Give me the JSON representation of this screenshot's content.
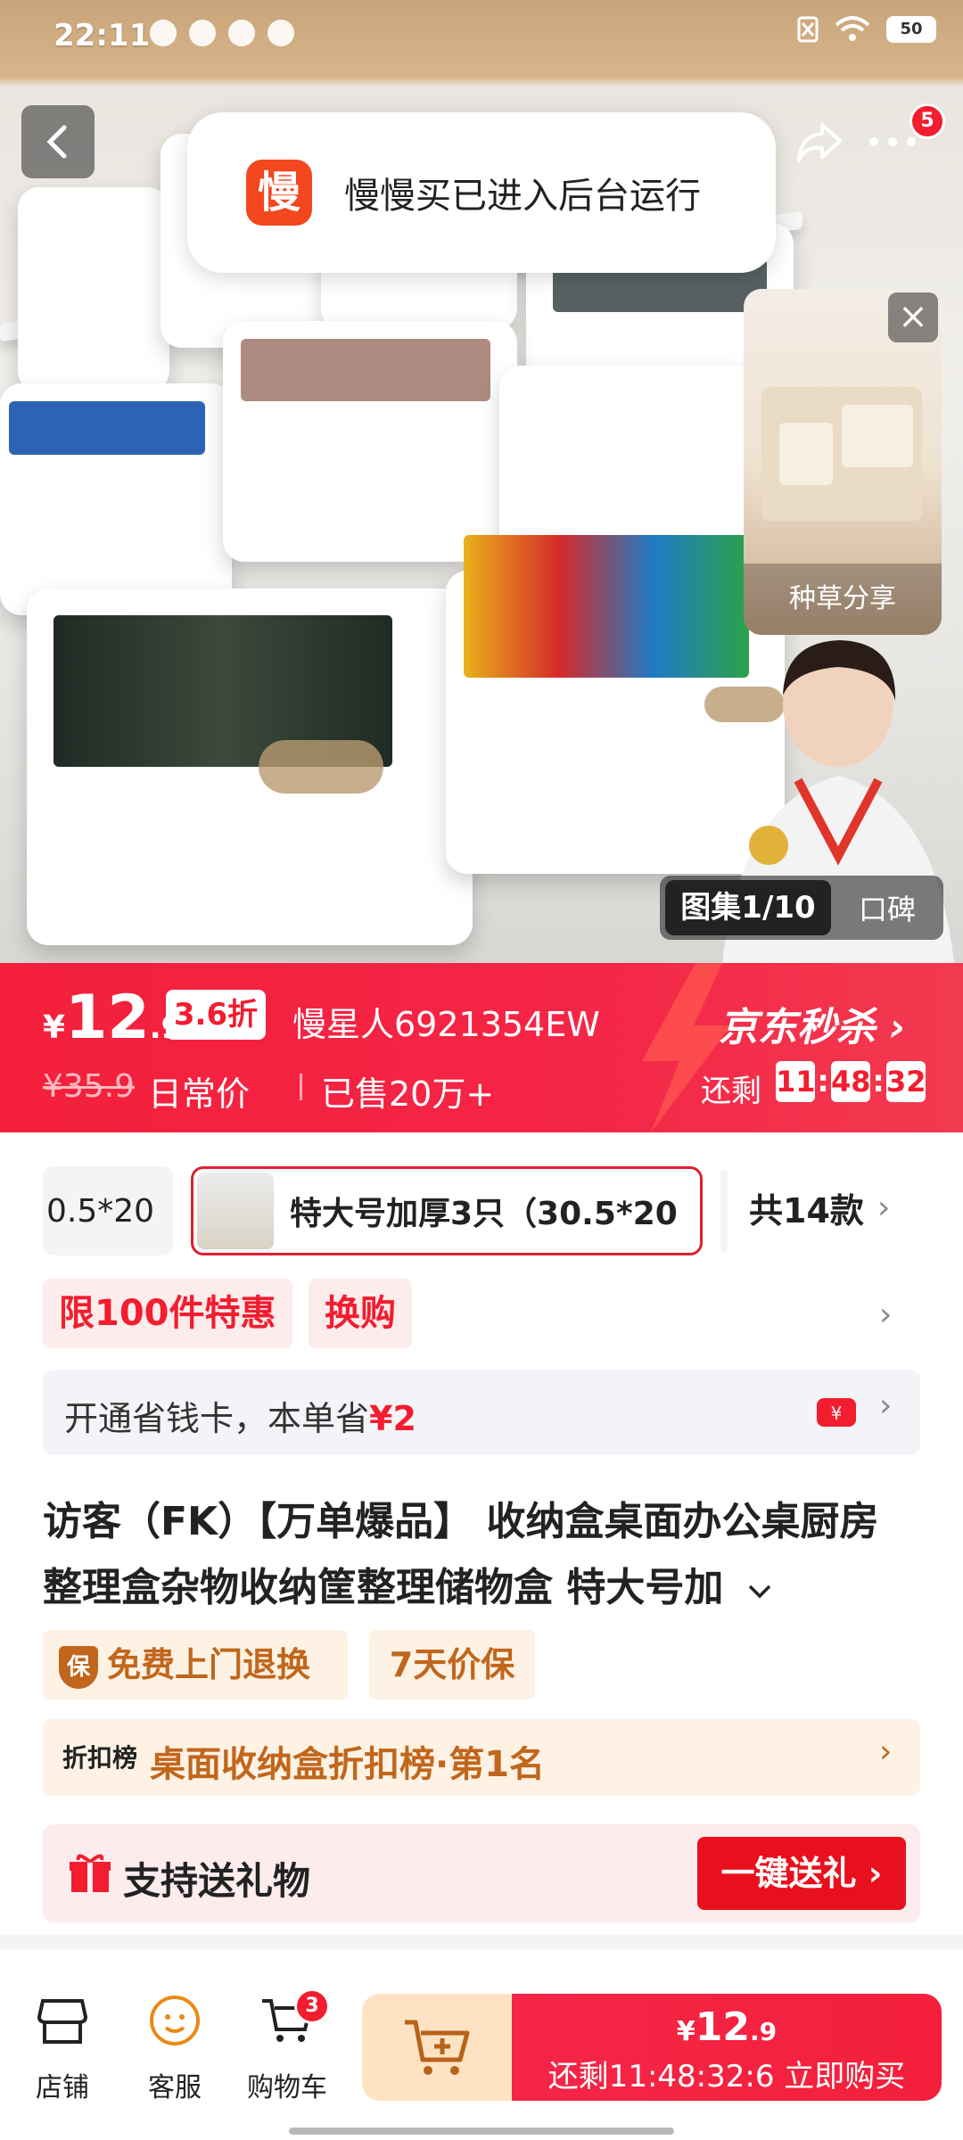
{
  "status_bar": {
    "time": "22:11",
    "battery": "50"
  },
  "toast": {
    "logo_char": "慢",
    "message": "慢慢买已进入后台运行"
  },
  "nav": {
    "cart_badge": "5"
  },
  "float_card": {
    "caption": "种草分享"
  },
  "gallery": {
    "tab_active": "图集1/10",
    "tab_other": "口碑"
  },
  "price_banner": {
    "currency": "¥",
    "price_int": "12",
    "price_dec": ".9",
    "discount": "3.6折",
    "sku": "慢星人6921354EW",
    "original_price": "¥35.9",
    "daily_label": "日常价",
    "sold": "已售20万+",
    "brand": "京东秒杀",
    "remain_label": "还剩",
    "timer_h": "11",
    "timer_m": "48",
    "timer_s": "32"
  },
  "variants": {
    "prev_label": "0.5*20",
    "selected_label": "特大号加厚3只（30.5*20",
    "total_label": "共14款"
  },
  "promos": {
    "tag1": "限100件特惠",
    "tag2": "换购"
  },
  "saving_card": {
    "text": "开通省钱卡，本单省",
    "amount": "¥2"
  },
  "product": {
    "title": "访客（FK）【万单爆品】 收纳盒桌面办公桌厨房整理盒杂物收纳筐整理储物盒 特大号加"
  },
  "guarantees": {
    "g1": "免费上门退换",
    "g1_icon": "保",
    "g2": "7天价保"
  },
  "rank": {
    "label": "折扣榜",
    "text": "桌面收纳盒折扣榜·第1名"
  },
  "gift": {
    "text": "支持送礼物",
    "button": "一键送礼"
  },
  "bottom_bar": {
    "store": "店铺",
    "service": "客服",
    "cart": "购物车",
    "cart_badge": "3",
    "buy_price_cur": "¥",
    "buy_price_int": "12",
    "buy_price_dec": ".9",
    "buy_sub": "还剩11:48:32:6 立即购买"
  },
  "colors": {
    "accent": "#f21d2f",
    "gold": "#c1661c"
  }
}
